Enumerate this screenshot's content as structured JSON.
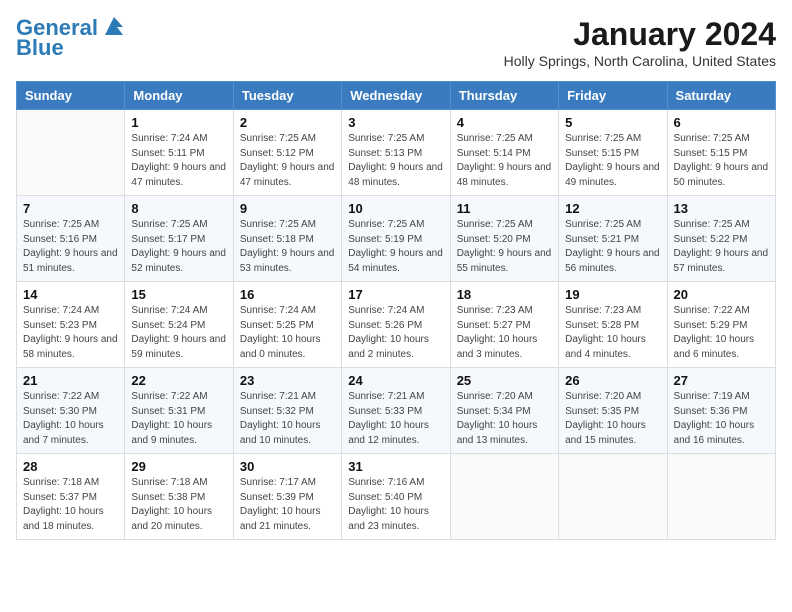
{
  "header": {
    "logo_line1": "General",
    "logo_line2": "Blue",
    "month_title": "January 2024",
    "location": "Holly Springs, North Carolina, United States"
  },
  "weekdays": [
    "Sunday",
    "Monday",
    "Tuesday",
    "Wednesday",
    "Thursday",
    "Friday",
    "Saturday"
  ],
  "weeks": [
    [
      {
        "day": "",
        "sunrise": "",
        "sunset": "",
        "daylight": ""
      },
      {
        "day": "1",
        "sunrise": "Sunrise: 7:24 AM",
        "sunset": "Sunset: 5:11 PM",
        "daylight": "Daylight: 9 hours and 47 minutes."
      },
      {
        "day": "2",
        "sunrise": "Sunrise: 7:25 AM",
        "sunset": "Sunset: 5:12 PM",
        "daylight": "Daylight: 9 hours and 47 minutes."
      },
      {
        "day": "3",
        "sunrise": "Sunrise: 7:25 AM",
        "sunset": "Sunset: 5:13 PM",
        "daylight": "Daylight: 9 hours and 48 minutes."
      },
      {
        "day": "4",
        "sunrise": "Sunrise: 7:25 AM",
        "sunset": "Sunset: 5:14 PM",
        "daylight": "Daylight: 9 hours and 48 minutes."
      },
      {
        "day": "5",
        "sunrise": "Sunrise: 7:25 AM",
        "sunset": "Sunset: 5:15 PM",
        "daylight": "Daylight: 9 hours and 49 minutes."
      },
      {
        "day": "6",
        "sunrise": "Sunrise: 7:25 AM",
        "sunset": "Sunset: 5:15 PM",
        "daylight": "Daylight: 9 hours and 50 minutes."
      }
    ],
    [
      {
        "day": "7",
        "sunrise": "Sunrise: 7:25 AM",
        "sunset": "Sunset: 5:16 PM",
        "daylight": "Daylight: 9 hours and 51 minutes."
      },
      {
        "day": "8",
        "sunrise": "Sunrise: 7:25 AM",
        "sunset": "Sunset: 5:17 PM",
        "daylight": "Daylight: 9 hours and 52 minutes."
      },
      {
        "day": "9",
        "sunrise": "Sunrise: 7:25 AM",
        "sunset": "Sunset: 5:18 PM",
        "daylight": "Daylight: 9 hours and 53 minutes."
      },
      {
        "day": "10",
        "sunrise": "Sunrise: 7:25 AM",
        "sunset": "Sunset: 5:19 PM",
        "daylight": "Daylight: 9 hours and 54 minutes."
      },
      {
        "day": "11",
        "sunrise": "Sunrise: 7:25 AM",
        "sunset": "Sunset: 5:20 PM",
        "daylight": "Daylight: 9 hours and 55 minutes."
      },
      {
        "day": "12",
        "sunrise": "Sunrise: 7:25 AM",
        "sunset": "Sunset: 5:21 PM",
        "daylight": "Daylight: 9 hours and 56 minutes."
      },
      {
        "day": "13",
        "sunrise": "Sunrise: 7:25 AM",
        "sunset": "Sunset: 5:22 PM",
        "daylight": "Daylight: 9 hours and 57 minutes."
      }
    ],
    [
      {
        "day": "14",
        "sunrise": "Sunrise: 7:24 AM",
        "sunset": "Sunset: 5:23 PM",
        "daylight": "Daylight: 9 hours and 58 minutes."
      },
      {
        "day": "15",
        "sunrise": "Sunrise: 7:24 AM",
        "sunset": "Sunset: 5:24 PM",
        "daylight": "Daylight: 9 hours and 59 minutes."
      },
      {
        "day": "16",
        "sunrise": "Sunrise: 7:24 AM",
        "sunset": "Sunset: 5:25 PM",
        "daylight": "Daylight: 10 hours and 0 minutes."
      },
      {
        "day": "17",
        "sunrise": "Sunrise: 7:24 AM",
        "sunset": "Sunset: 5:26 PM",
        "daylight": "Daylight: 10 hours and 2 minutes."
      },
      {
        "day": "18",
        "sunrise": "Sunrise: 7:23 AM",
        "sunset": "Sunset: 5:27 PM",
        "daylight": "Daylight: 10 hours and 3 minutes."
      },
      {
        "day": "19",
        "sunrise": "Sunrise: 7:23 AM",
        "sunset": "Sunset: 5:28 PM",
        "daylight": "Daylight: 10 hours and 4 minutes."
      },
      {
        "day": "20",
        "sunrise": "Sunrise: 7:22 AM",
        "sunset": "Sunset: 5:29 PM",
        "daylight": "Daylight: 10 hours and 6 minutes."
      }
    ],
    [
      {
        "day": "21",
        "sunrise": "Sunrise: 7:22 AM",
        "sunset": "Sunset: 5:30 PM",
        "daylight": "Daylight: 10 hours and 7 minutes."
      },
      {
        "day": "22",
        "sunrise": "Sunrise: 7:22 AM",
        "sunset": "Sunset: 5:31 PM",
        "daylight": "Daylight: 10 hours and 9 minutes."
      },
      {
        "day": "23",
        "sunrise": "Sunrise: 7:21 AM",
        "sunset": "Sunset: 5:32 PM",
        "daylight": "Daylight: 10 hours and 10 minutes."
      },
      {
        "day": "24",
        "sunrise": "Sunrise: 7:21 AM",
        "sunset": "Sunset: 5:33 PM",
        "daylight": "Daylight: 10 hours and 12 minutes."
      },
      {
        "day": "25",
        "sunrise": "Sunrise: 7:20 AM",
        "sunset": "Sunset: 5:34 PM",
        "daylight": "Daylight: 10 hours and 13 minutes."
      },
      {
        "day": "26",
        "sunrise": "Sunrise: 7:20 AM",
        "sunset": "Sunset: 5:35 PM",
        "daylight": "Daylight: 10 hours and 15 minutes."
      },
      {
        "day": "27",
        "sunrise": "Sunrise: 7:19 AM",
        "sunset": "Sunset: 5:36 PM",
        "daylight": "Daylight: 10 hours and 16 minutes."
      }
    ],
    [
      {
        "day": "28",
        "sunrise": "Sunrise: 7:18 AM",
        "sunset": "Sunset: 5:37 PM",
        "daylight": "Daylight: 10 hours and 18 minutes."
      },
      {
        "day": "29",
        "sunrise": "Sunrise: 7:18 AM",
        "sunset": "Sunset: 5:38 PM",
        "daylight": "Daylight: 10 hours and 20 minutes."
      },
      {
        "day": "30",
        "sunrise": "Sunrise: 7:17 AM",
        "sunset": "Sunset: 5:39 PM",
        "daylight": "Daylight: 10 hours and 21 minutes."
      },
      {
        "day": "31",
        "sunrise": "Sunrise: 7:16 AM",
        "sunset": "Sunset: 5:40 PM",
        "daylight": "Daylight: 10 hours and 23 minutes."
      },
      {
        "day": "",
        "sunrise": "",
        "sunset": "",
        "daylight": ""
      },
      {
        "day": "",
        "sunrise": "",
        "sunset": "",
        "daylight": ""
      },
      {
        "day": "",
        "sunrise": "",
        "sunset": "",
        "daylight": ""
      }
    ]
  ]
}
